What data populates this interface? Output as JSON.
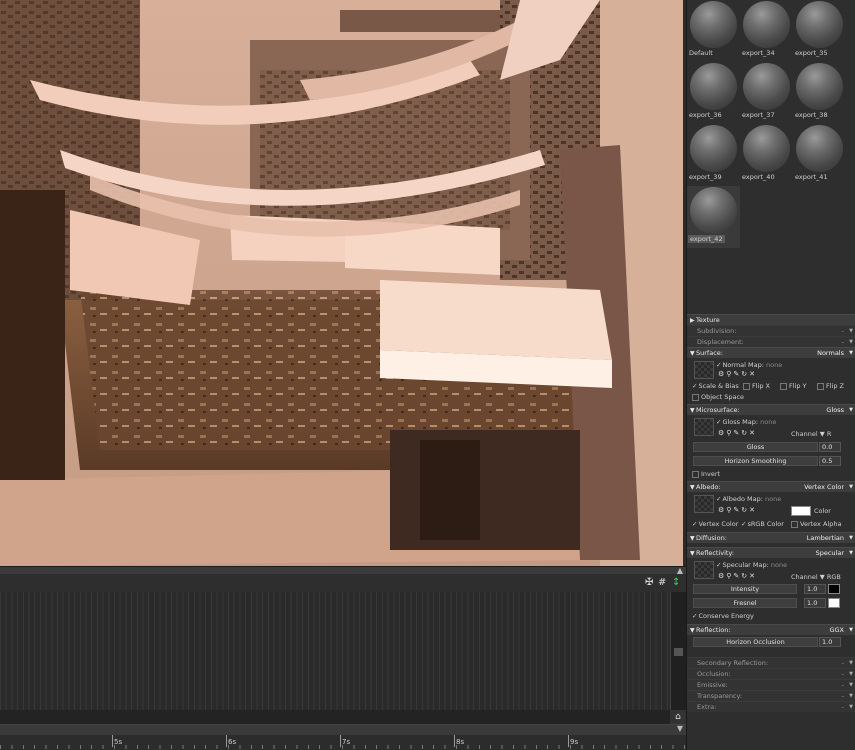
{
  "materials": [
    {
      "name": "Default"
    },
    {
      "name": "export_34"
    },
    {
      "name": "export_35"
    },
    {
      "name": "export_36"
    },
    {
      "name": "export_37"
    },
    {
      "name": "export_38"
    },
    {
      "name": "export_39"
    },
    {
      "name": "export_40"
    },
    {
      "name": "export_41"
    },
    {
      "name": "export_42",
      "selected": true
    }
  ],
  "texture": {
    "title": "Texture",
    "subdivision": "Subdivision:",
    "displacement": "Displacement:",
    "dash": "-"
  },
  "surface": {
    "title": "Surface:",
    "mode": "Normals",
    "map_label": "Normal Map:",
    "map_value": "none",
    "scale_bias": "Scale & Bias",
    "flip_x": "Flip X",
    "flip_y": "Flip Y",
    "flip_z": "Flip Z",
    "object_space": "Object Space"
  },
  "microsurface": {
    "title": "Microsurface:",
    "mode": "Gloss",
    "map_label": "Gloss Map:",
    "map_value": "none",
    "channel_label": "Channel",
    "channel_value": "R",
    "gloss_label": "Gloss",
    "gloss_value": "0.0",
    "horizon_label": "Horizon Smoothing",
    "horizon_value": "0.5",
    "invert": "Invert"
  },
  "albedo": {
    "title": "Albedo:",
    "mode": "Vertex Color",
    "map_label": "Albedo Map:",
    "map_value": "none",
    "color_label": "Color",
    "color_hex": "#ffffff",
    "vertex_color": "Vertex Color",
    "srgb_color": "sRGB Color",
    "vertex_alpha": "Vertex Alpha"
  },
  "diffusion": {
    "title": "Diffusion:",
    "mode": "Lambertian"
  },
  "reflectivity": {
    "title": "Reflectivity:",
    "mode": "Specular",
    "map_label": "Specular Map:",
    "map_value": "none",
    "channel_label": "Channel",
    "channel_value": "RGB",
    "intensity_label": "Intensity",
    "intensity_value": "1.0",
    "intensity_color": "#000000",
    "fresnel_label": "Fresnel",
    "fresnel_value": "1.0",
    "fresnel_color": "#ffffff",
    "conserve": "Conserve Energy"
  },
  "reflection": {
    "title": "Reflection:",
    "mode": "GGX",
    "horizon_label": "Horizon Occlusion",
    "horizon_value": "1.0"
  },
  "collapsed": {
    "secondary": "Secondary Reflection:",
    "occlusion": "Occlusion:",
    "emissive": "Emissive:",
    "transparency": "Transparency:",
    "extra": "Extra:",
    "dash": "-"
  },
  "timeline": {
    "tools": {
      "icon1": "✠",
      "icon2": "#",
      "icon3": "↕"
    },
    "labels": [
      "5s",
      "6s",
      "7s",
      "8s",
      "9s"
    ]
  }
}
